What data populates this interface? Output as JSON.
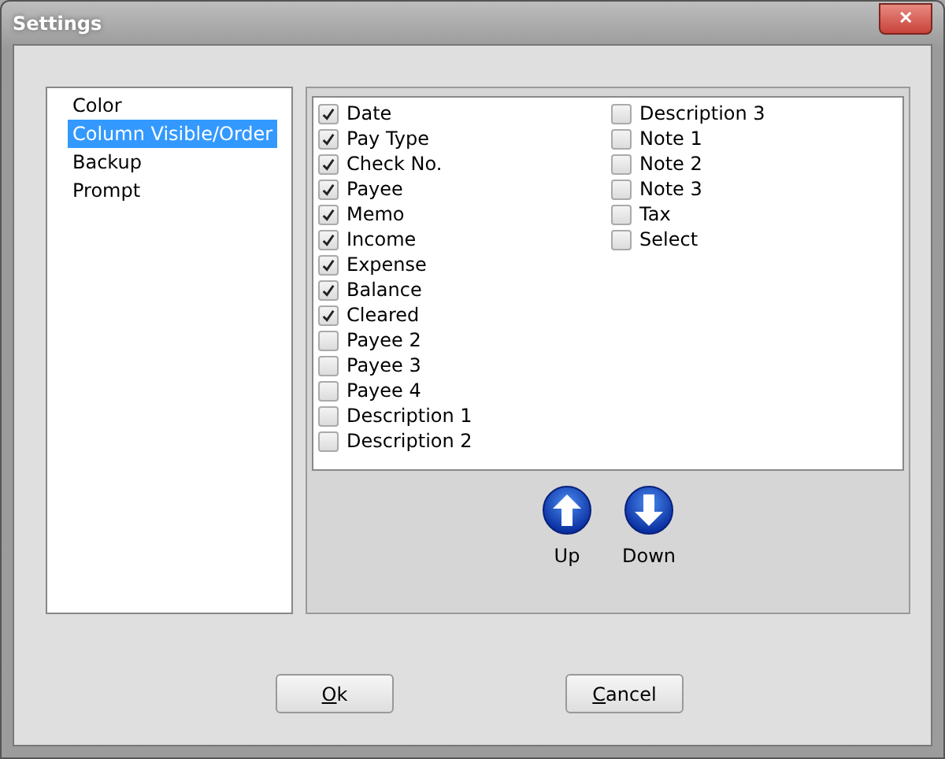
{
  "window": {
    "title": "Settings",
    "close": "✕"
  },
  "sidebar": {
    "items": [
      {
        "label": "Color",
        "selected": false
      },
      {
        "label": "Column Visible/Order",
        "selected": true
      },
      {
        "label": "Backup",
        "selected": false
      },
      {
        "label": "Prompt",
        "selected": false
      }
    ]
  },
  "columns": [
    {
      "label": "Date",
      "checked": true
    },
    {
      "label": "Pay Type",
      "checked": true
    },
    {
      "label": "Check No.",
      "checked": true
    },
    {
      "label": "Payee",
      "checked": true
    },
    {
      "label": "Memo",
      "checked": true
    },
    {
      "label": "Income",
      "checked": true
    },
    {
      "label": "Expense",
      "checked": true
    },
    {
      "label": "Balance",
      "checked": true
    },
    {
      "label": "Cleared",
      "checked": true
    },
    {
      "label": "Payee 2",
      "checked": false
    },
    {
      "label": "Payee 3",
      "checked": false
    },
    {
      "label": "Payee 4",
      "checked": false
    },
    {
      "label": "Description 1",
      "checked": false
    },
    {
      "label": "Description 2",
      "checked": false
    },
    {
      "label": "Description 3",
      "checked": false
    },
    {
      "label": "Note 1",
      "checked": false
    },
    {
      "label": "Note 2",
      "checked": false
    },
    {
      "label": "Note 3",
      "checked": false
    },
    {
      "label": "Tax",
      "checked": false
    },
    {
      "label": "Select",
      "checked": false
    }
  ],
  "move_buttons": [
    {
      "kind": "up",
      "label": "Up"
    },
    {
      "kind": "down",
      "label": "Down"
    }
  ],
  "buttons": [
    {
      "key": "O",
      "rest": "k"
    },
    {
      "key": "C",
      "rest": "ancel"
    }
  ]
}
